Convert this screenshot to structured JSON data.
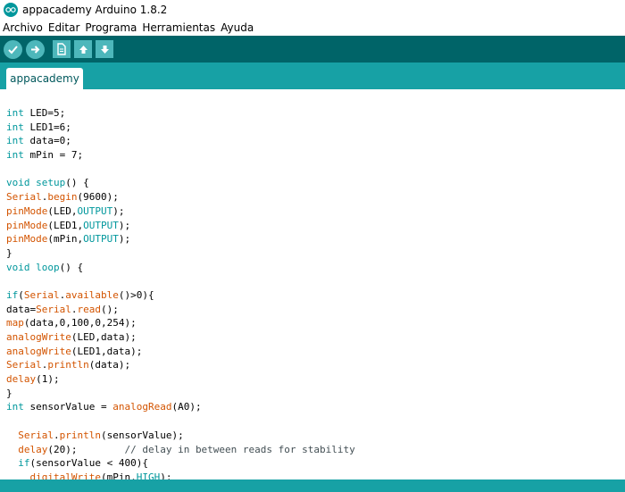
{
  "window": {
    "title": "appacademy Arduino 1.8.2"
  },
  "menu": [
    "Archivo",
    "Editar",
    "Programa",
    "Herramientas",
    "Ayuda"
  ],
  "toolbar": {
    "buttons": [
      "verify-icon",
      "upload-icon",
      "new-icon",
      "open-icon",
      "save-icon"
    ]
  },
  "tabs": [
    {
      "label": "appacademy"
    }
  ],
  "colors": {
    "toolbar": "#006468",
    "tab_strip": "#17a1a5",
    "keyword": "#00979c",
    "function": "#d35400",
    "comment": "#434f54"
  },
  "editor": {
    "lines": [
      [
        {
          "t": "kw",
          "s": "int"
        },
        {
          "t": "p",
          "s": " LED=5;"
        }
      ],
      [
        {
          "t": "kw",
          "s": "int"
        },
        {
          "t": "p",
          "s": " LED1=6;"
        }
      ],
      [
        {
          "t": "kw",
          "s": "int"
        },
        {
          "t": "p",
          "s": " data=0;"
        }
      ],
      [
        {
          "t": "kw",
          "s": "int"
        },
        {
          "t": "p",
          "s": " mPin = 7;"
        }
      ],
      [],
      [
        {
          "t": "kw",
          "s": "void"
        },
        {
          "t": "p",
          "s": " "
        },
        {
          "t": "kw",
          "s": "setup"
        },
        {
          "t": "p",
          "s": "() {"
        }
      ],
      [
        {
          "t": "fn",
          "s": "Serial"
        },
        {
          "t": "p",
          "s": "."
        },
        {
          "t": "fn",
          "s": "begin"
        },
        {
          "t": "p",
          "s": "(9600);"
        }
      ],
      [
        {
          "t": "fn",
          "s": "pinMode"
        },
        {
          "t": "p",
          "s": "(LED,"
        },
        {
          "t": "kw",
          "s": "OUTPUT"
        },
        {
          "t": "p",
          "s": ");"
        }
      ],
      [
        {
          "t": "fn",
          "s": "pinMode"
        },
        {
          "t": "p",
          "s": "(LED1,"
        },
        {
          "t": "kw",
          "s": "OUTPUT"
        },
        {
          "t": "p",
          "s": ");"
        }
      ],
      [
        {
          "t": "fn",
          "s": "pinMode"
        },
        {
          "t": "p",
          "s": "(mPin,"
        },
        {
          "t": "kw",
          "s": "OUTPUT"
        },
        {
          "t": "p",
          "s": ");"
        }
      ],
      [
        {
          "t": "p",
          "s": "}"
        }
      ],
      [
        {
          "t": "kw",
          "s": "void"
        },
        {
          "t": "p",
          "s": " "
        },
        {
          "t": "kw",
          "s": "loop"
        },
        {
          "t": "p",
          "s": "() {"
        }
      ],
      [],
      [
        {
          "t": "kw",
          "s": "if"
        },
        {
          "t": "p",
          "s": "("
        },
        {
          "t": "fn",
          "s": "Serial"
        },
        {
          "t": "p",
          "s": "."
        },
        {
          "t": "fn",
          "s": "available"
        },
        {
          "t": "p",
          "s": "()>0){"
        }
      ],
      [
        {
          "t": "p",
          "s": "data="
        },
        {
          "t": "fn",
          "s": "Serial"
        },
        {
          "t": "p",
          "s": "."
        },
        {
          "t": "fn",
          "s": "read"
        },
        {
          "t": "p",
          "s": "();"
        }
      ],
      [
        {
          "t": "fn",
          "s": "map"
        },
        {
          "t": "p",
          "s": "(data,0,100,0,254);"
        }
      ],
      [
        {
          "t": "fn",
          "s": "analogWrite"
        },
        {
          "t": "p",
          "s": "(LED,data);"
        }
      ],
      [
        {
          "t": "fn",
          "s": "analogWrite"
        },
        {
          "t": "p",
          "s": "(LED1,data);"
        }
      ],
      [
        {
          "t": "fn",
          "s": "Serial"
        },
        {
          "t": "p",
          "s": "."
        },
        {
          "t": "fn",
          "s": "println"
        },
        {
          "t": "p",
          "s": "(data);"
        }
      ],
      [
        {
          "t": "fn",
          "s": "delay"
        },
        {
          "t": "p",
          "s": "(1);"
        }
      ],
      [
        {
          "t": "p",
          "s": "}"
        }
      ],
      [
        {
          "t": "kw",
          "s": "int"
        },
        {
          "t": "p",
          "s": " sensorValue = "
        },
        {
          "t": "fn",
          "s": "analogRead"
        },
        {
          "t": "p",
          "s": "(A0);"
        }
      ],
      [],
      [
        {
          "t": "p",
          "s": "  "
        },
        {
          "t": "fn",
          "s": "Serial"
        },
        {
          "t": "p",
          "s": "."
        },
        {
          "t": "fn",
          "s": "println"
        },
        {
          "t": "p",
          "s": "(sensorValue);"
        }
      ],
      [
        {
          "t": "p",
          "s": "  "
        },
        {
          "t": "fn",
          "s": "delay"
        },
        {
          "t": "p",
          "s": "(20);        "
        },
        {
          "t": "cmt",
          "s": "// delay in between reads for stability"
        }
      ],
      [
        {
          "t": "p",
          "s": "  "
        },
        {
          "t": "kw",
          "s": "if"
        },
        {
          "t": "p",
          "s": "(sensorValue < 400){"
        }
      ],
      [
        {
          "t": "p",
          "s": "    "
        },
        {
          "t": "fn",
          "s": "digitalWrite"
        },
        {
          "t": "p",
          "s": "(mPin,"
        },
        {
          "t": "kw",
          "s": "HIGH"
        },
        {
          "t": "p",
          "s": ");"
        }
      ]
    ]
  }
}
